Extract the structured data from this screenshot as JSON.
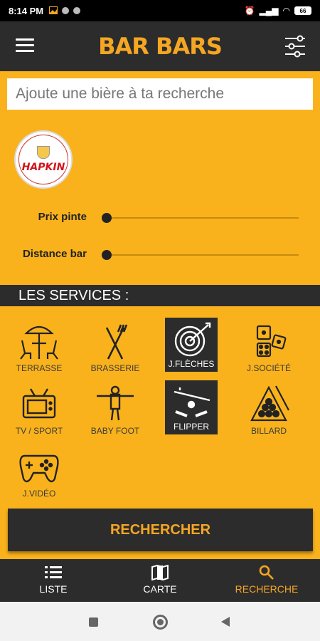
{
  "status_bar": {
    "time": "8:14 PM",
    "battery": "66"
  },
  "app": {
    "logo_text": "BAR BARS",
    "brand_color": "#f5a623",
    "bg_color": "#f9b21c"
  },
  "search": {
    "placeholder": "Ajoute une bière à ta recherche",
    "value": ""
  },
  "beer": {
    "name": "HAPKIN"
  },
  "sliders": [
    {
      "label": "Prix pinte",
      "value": 0
    },
    {
      "label": "Distance bar",
      "value": 0
    }
  ],
  "services": {
    "title": "LES SERVICES :",
    "items": [
      {
        "label": "TERRASSE",
        "icon": "terrace-icon",
        "selected": false
      },
      {
        "label": "BRASSERIE",
        "icon": "fork-knife-icon",
        "selected": false
      },
      {
        "label": "J.FLÈCHES",
        "icon": "dartboard-icon",
        "selected": true
      },
      {
        "label": "J.SOCIÉTÉ",
        "icon": "dice-icon",
        "selected": false
      },
      {
        "label": "TV / SPORT",
        "icon": "tv-icon",
        "selected": false
      },
      {
        "label": "BABY FOOT",
        "icon": "foosball-icon",
        "selected": false
      },
      {
        "label": "FLIPPER",
        "icon": "pinball-icon",
        "selected": true
      },
      {
        "label": "BILLARD",
        "icon": "billiard-icon",
        "selected": false
      },
      {
        "label": "J.VIDÉO",
        "icon": "gamepad-icon",
        "selected": false
      }
    ]
  },
  "search_button": {
    "label": "RECHERCHER"
  },
  "bottom_nav": [
    {
      "label": "LISTE",
      "icon": "list-icon",
      "active": false
    },
    {
      "label": "CARTE",
      "icon": "map-icon",
      "active": false
    },
    {
      "label": "RECHERCHE",
      "icon": "search-icon",
      "active": true
    }
  ]
}
